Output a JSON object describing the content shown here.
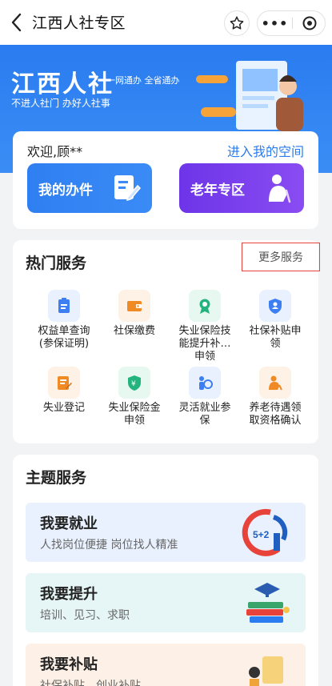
{
  "header": {
    "title": "江西人社专区",
    "more_label": "•••"
  },
  "banner": {
    "brand": "江西人社",
    "tagline": "一网通办 全省通办",
    "slogan": "不进人社门 办好人社事"
  },
  "welcome": {
    "greeting": "欢迎,顾**",
    "enter_space": "进入我的空间"
  },
  "quick": {
    "my_handle": "我的办件",
    "elder": "老年专区"
  },
  "hot": {
    "title": "热门服务",
    "more": "更多服务",
    "items": [
      {
        "label": "权益单查询\n(参保证明)",
        "icon": "clipboard-icon",
        "color": "#3d7ef2",
        "bg": "#eaf1fe"
      },
      {
        "label": "社保缴费",
        "icon": "wallet-icon",
        "color": "#f08a24",
        "bg": "#fef2e6"
      },
      {
        "label": "失业保险技\n能提升补…\n申领",
        "icon": "award-icon",
        "color": "#23b47e",
        "bg": "#e7f8f1"
      },
      {
        "label": "社保补贴申\n领",
        "icon": "shield-user-icon",
        "color": "#3d7ef2",
        "bg": "#eaf1fe"
      },
      {
        "label": "失业登记",
        "icon": "register-icon",
        "color": "#f08a24",
        "bg": "#fef2e6"
      },
      {
        "label": "失业保险金\n申领",
        "icon": "money-shield-icon",
        "color": "#23b47e",
        "bg": "#e7f8f1"
      },
      {
        "label": "灵活就业参\n保",
        "icon": "person-coin-icon",
        "color": "#3d7ef2",
        "bg": "#eaf1fe"
      },
      {
        "label": "养老待遇领\n取资格确认",
        "icon": "elder-person-icon",
        "color": "#f08a24",
        "bg": "#fef2e6"
      }
    ]
  },
  "themes": {
    "title": "主题服务",
    "items": [
      {
        "title": "我要就业",
        "desc": "人找岗位便捷 岗位找人精准",
        "bg": "#e8f1fd",
        "icon": "employment-logo-icon",
        "logo_text": "5+2"
      },
      {
        "title": "我要提升",
        "desc": "培训、见习、求职",
        "bg": "#e6f6f6",
        "icon": "books-icon"
      },
      {
        "title": "我要补贴",
        "desc": "社保补贴、创业补贴",
        "bg": "#fdf1e7",
        "icon": "subsidy-icon"
      }
    ]
  }
}
